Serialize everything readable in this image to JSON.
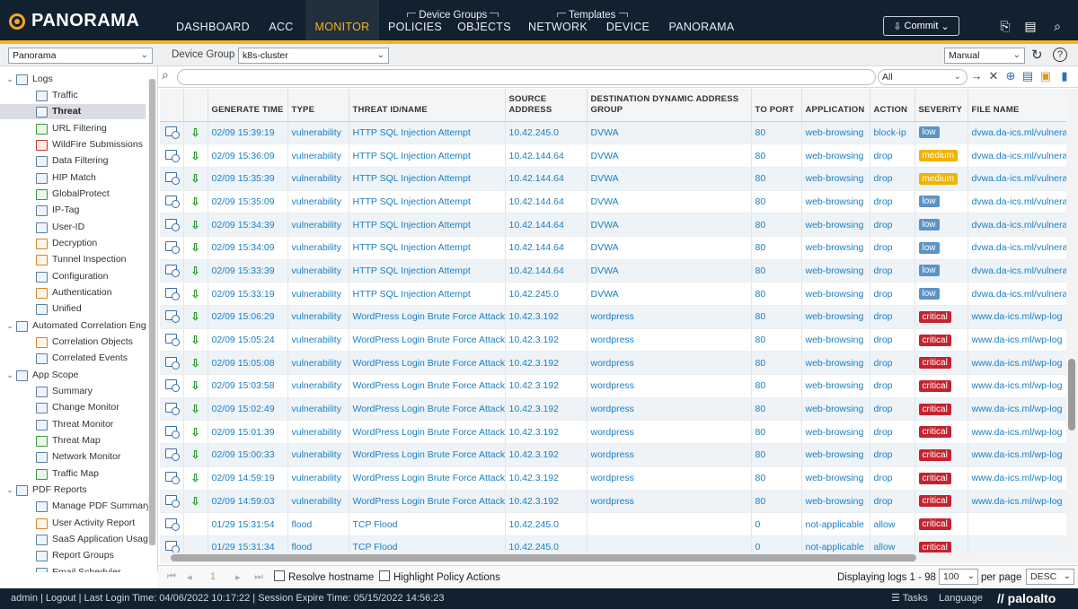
{
  "page_title": "",
  "nav": {
    "logo": "PANORAMA",
    "tabs": [
      "DASHBOARD",
      "ACC",
      "MONITOR",
      "POLICIES",
      "OBJECTS",
      "NETWORK",
      "DEVICE",
      "PANORAMA"
    ],
    "active_tab": "MONITOR",
    "device_groups_label": "Device Groups",
    "templates_label": "Templates",
    "commit": "Commit"
  },
  "context": {
    "panorama_select": "Panorama",
    "device_group_label": "Device Group",
    "device_group_value": "k8s-cluster",
    "refresh_mode": "Manual"
  },
  "sidebar": {
    "logs_label": "Logs",
    "logs_items": [
      "Traffic",
      "Threat",
      "URL Filtering",
      "WildFire Submissions",
      "Data Filtering",
      "HIP Match",
      "GlobalProtect",
      "IP-Tag",
      "User-ID",
      "Decryption",
      "Tunnel Inspection",
      "Configuration",
      "Authentication",
      "Unified"
    ],
    "active_item": "Threat",
    "acel_label": "Automated Correlation Eng",
    "acel_items": [
      "Correlation Objects",
      "Correlated Events"
    ],
    "appscope_label": "App Scope",
    "appscope_items": [
      "Summary",
      "Change Monitor",
      "Threat Monitor",
      "Threat Map",
      "Network Monitor",
      "Traffic Map"
    ],
    "pdf_label": "PDF Reports",
    "pdf_items": [
      "Manage PDF Summary",
      "User Activity Report",
      "SaaS Application Usage",
      "Report Groups",
      "Email Scheduler"
    ]
  },
  "filter": {
    "value": "",
    "scope": "All"
  },
  "table": {
    "columns": [
      "GENERATE TIME",
      "TYPE",
      "THREAT ID/NAME",
      "SOURCE ADDRESS",
      "DESTINATION DYNAMIC ADDRESS GROUP",
      "TO PORT",
      "APPLICATION",
      "ACTION",
      "SEVERITY",
      "FILE NAME"
    ],
    "rows": [
      {
        "time": "02/09 15:39:19",
        "type": "vulnerability",
        "threat": "HTTP SQL Injection Attempt",
        "src": "10.42.245.0",
        "dag": "DVWA",
        "port": "80",
        "app": "web-browsing",
        "action": "block-ip",
        "severity": "low",
        "file": "dvwa.da-ics.ml/vulnera",
        "dl": true
      },
      {
        "time": "02/09 15:36:09",
        "type": "vulnerability",
        "threat": "HTTP SQL Injection Attempt",
        "src": "10.42.144.64",
        "dag": "DVWA",
        "port": "80",
        "app": "web-browsing",
        "action": "drop",
        "severity": "medium",
        "file": "dvwa.da-ics.ml/vulnera",
        "dl": true
      },
      {
        "time": "02/09 15:35:39",
        "type": "vulnerability",
        "threat": "HTTP SQL Injection Attempt",
        "src": "10.42.144.64",
        "dag": "DVWA",
        "port": "80",
        "app": "web-browsing",
        "action": "drop",
        "severity": "medium",
        "file": "dvwa.da-ics.ml/vulnera",
        "dl": true
      },
      {
        "time": "02/09 15:35:09",
        "type": "vulnerability",
        "threat": "HTTP SQL Injection Attempt",
        "src": "10.42.144.64",
        "dag": "DVWA",
        "port": "80",
        "app": "web-browsing",
        "action": "drop",
        "severity": "low",
        "file": "dvwa.da-ics.ml/vulnera",
        "dl": true
      },
      {
        "time": "02/09 15:34:39",
        "type": "vulnerability",
        "threat": "HTTP SQL Injection Attempt",
        "src": "10.42.144.64",
        "dag": "DVWA",
        "port": "80",
        "app": "web-browsing",
        "action": "drop",
        "severity": "low",
        "file": "dvwa.da-ics.ml/vulnera",
        "dl": true
      },
      {
        "time": "02/09 15:34:09",
        "type": "vulnerability",
        "threat": "HTTP SQL Injection Attempt",
        "src": "10.42.144.64",
        "dag": "DVWA",
        "port": "80",
        "app": "web-browsing",
        "action": "drop",
        "severity": "low",
        "file": "dvwa.da-ics.ml/vulnera",
        "dl": true
      },
      {
        "time": "02/09 15:33:39",
        "type": "vulnerability",
        "threat": "HTTP SQL Injection Attempt",
        "src": "10.42.144.64",
        "dag": "DVWA",
        "port": "80",
        "app": "web-browsing",
        "action": "drop",
        "severity": "low",
        "file": "dvwa.da-ics.ml/vulnera",
        "dl": true
      },
      {
        "time": "02/09 15:33:19",
        "type": "vulnerability",
        "threat": "HTTP SQL Injection Attempt",
        "src": "10.42.245.0",
        "dag": "DVWA",
        "port": "80",
        "app": "web-browsing",
        "action": "drop",
        "severity": "low",
        "file": "dvwa.da-ics.ml/vulnera",
        "dl": true
      },
      {
        "time": "02/09 15:06:29",
        "type": "vulnerability",
        "threat": "WordPress Login Brute Force Attack",
        "src": "10.42.3.192",
        "dag": "wordpress",
        "port": "80",
        "app": "web-browsing",
        "action": "drop",
        "severity": "critical",
        "file": "www.da-ics.ml/wp-log",
        "dl": true
      },
      {
        "time": "02/09 15:05:24",
        "type": "vulnerability",
        "threat": "WordPress Login Brute Force Attack",
        "src": "10.42.3.192",
        "dag": "wordpress",
        "port": "80",
        "app": "web-browsing",
        "action": "drop",
        "severity": "critical",
        "file": "www.da-ics.ml/wp-log",
        "dl": true
      },
      {
        "time": "02/09 15:05:08",
        "type": "vulnerability",
        "threat": "WordPress Login Brute Force Attack",
        "src": "10.42.3.192",
        "dag": "wordpress",
        "port": "80",
        "app": "web-browsing",
        "action": "drop",
        "severity": "critical",
        "file": "www.da-ics.ml/wp-log",
        "dl": true
      },
      {
        "time": "02/09 15:03:58",
        "type": "vulnerability",
        "threat": "WordPress Login Brute Force Attack",
        "src": "10.42.3.192",
        "dag": "wordpress",
        "port": "80",
        "app": "web-browsing",
        "action": "drop",
        "severity": "critical",
        "file": "www.da-ics.ml/wp-log",
        "dl": true
      },
      {
        "time": "02/09 15:02:49",
        "type": "vulnerability",
        "threat": "WordPress Login Brute Force Attack",
        "src": "10.42.3.192",
        "dag": "wordpress",
        "port": "80",
        "app": "web-browsing",
        "action": "drop",
        "severity": "critical",
        "file": "www.da-ics.ml/wp-log",
        "dl": true
      },
      {
        "time": "02/09 15:01:39",
        "type": "vulnerability",
        "threat": "WordPress Login Brute Force Attack",
        "src": "10.42.3.192",
        "dag": "wordpress",
        "port": "80",
        "app": "web-browsing",
        "action": "drop",
        "severity": "critical",
        "file": "www.da-ics.ml/wp-log",
        "dl": true
      },
      {
        "time": "02/09 15:00:33",
        "type": "vulnerability",
        "threat": "WordPress Login Brute Force Attack",
        "src": "10.42.3.192",
        "dag": "wordpress",
        "port": "80",
        "app": "web-browsing",
        "action": "drop",
        "severity": "critical",
        "file": "www.da-ics.ml/wp-log",
        "dl": true
      },
      {
        "time": "02/09 14:59:19",
        "type": "vulnerability",
        "threat": "WordPress Login Brute Force Attack",
        "src": "10.42.3.192",
        "dag": "wordpress",
        "port": "80",
        "app": "web-browsing",
        "action": "drop",
        "severity": "critical",
        "file": "www.da-ics.ml/wp-log",
        "dl": true
      },
      {
        "time": "02/09 14:59:03",
        "type": "vulnerability",
        "threat": "WordPress Login Brute Force Attack",
        "src": "10.42.3.192",
        "dag": "wordpress",
        "port": "80",
        "app": "web-browsing",
        "action": "drop",
        "severity": "critical",
        "file": "www.da-ics.ml/wp-log",
        "dl": true
      },
      {
        "time": "01/29 15:31:54",
        "type": "flood",
        "threat": "TCP Flood",
        "src": "10.42.245.0",
        "dag": "",
        "port": "0",
        "app": "not-applicable",
        "action": "allow",
        "severity": "critical",
        "file": "",
        "dl": false
      },
      {
        "time": "01/29 15:31:34",
        "type": "flood",
        "threat": "TCP Flood",
        "src": "10.42.245.0",
        "dag": "",
        "port": "0",
        "app": "not-applicable",
        "action": "allow",
        "severity": "critical",
        "file": "",
        "dl": false
      }
    ]
  },
  "severity_colors": {
    "low": "#5b93c4",
    "medium": "#f0b400",
    "critical": "#c4232f"
  },
  "pager": {
    "page": "1",
    "resolve_hostname": "Resolve hostname",
    "highlight_policy": "Highlight Policy Actions",
    "displaying": "Displaying logs 1 - 98",
    "per_page_value": "100",
    "per_page_label": "per page",
    "sort_value": "DESC"
  },
  "status": {
    "text": "admin  |  Logout  |  Last Login Time: 04/06/2022 10:17:22  |  Session Expire Time: 05/15/2022 14:56:23",
    "tasks": "Tasks",
    "language": "Language",
    "brand": "paloalto"
  }
}
